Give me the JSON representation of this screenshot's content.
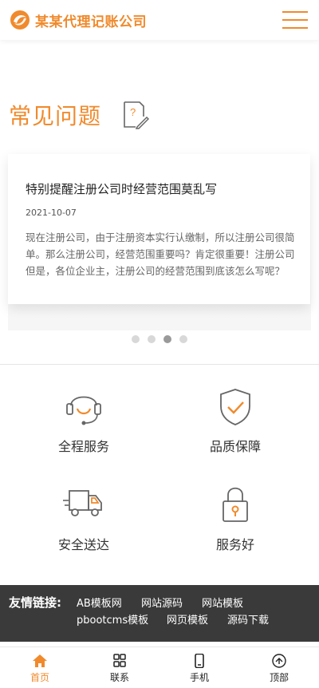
{
  "header": {
    "brand": "某某代理记账公司",
    "logo_icon": "orange-swirl-logo",
    "menu_icon": "hamburger-icon"
  },
  "colors": {
    "accent": "#f08a2c",
    "links_bg": "#3a3a3a",
    "icon_stroke": "#666666"
  },
  "faq": {
    "title": "常见问题",
    "title_icon": "question-document-edit-icon",
    "article": {
      "title": "特别提醒注册公司时经营范围莫乱写",
      "date": "2021-10-07",
      "excerpt": "现在注册公司，由于注册资本实行认缴制，所以注册公司很简单。那么注册公司，经营范围重要吗？肯定很重要！注册公司但是，各位企业主，注册公司的经营范围到底该怎么写呢？"
    },
    "slides": 4,
    "active_slide": 3
  },
  "features": [
    {
      "label": "全程服务",
      "icon": "headset-icon"
    },
    {
      "label": "品质保障",
      "icon": "shield-check-icon"
    },
    {
      "label": "安全送达",
      "icon": "delivery-truck-icon"
    },
    {
      "label": "服务好",
      "icon": "padlock-icon"
    }
  ],
  "friendly_links": {
    "title": "友情链接:",
    "items": [
      "AB模板网",
      "网站源码",
      "网站模板",
      "pbootcms模板",
      "网页模板",
      "源码下载"
    ]
  },
  "bottom_nav": [
    {
      "label": "首页",
      "icon": "home-icon",
      "active": true
    },
    {
      "label": "联系",
      "icon": "grid-icon",
      "active": false
    },
    {
      "label": "手机",
      "icon": "phone-icon",
      "active": false
    },
    {
      "label": "顶部",
      "icon": "arrow-up-circle-icon",
      "active": false
    }
  ]
}
